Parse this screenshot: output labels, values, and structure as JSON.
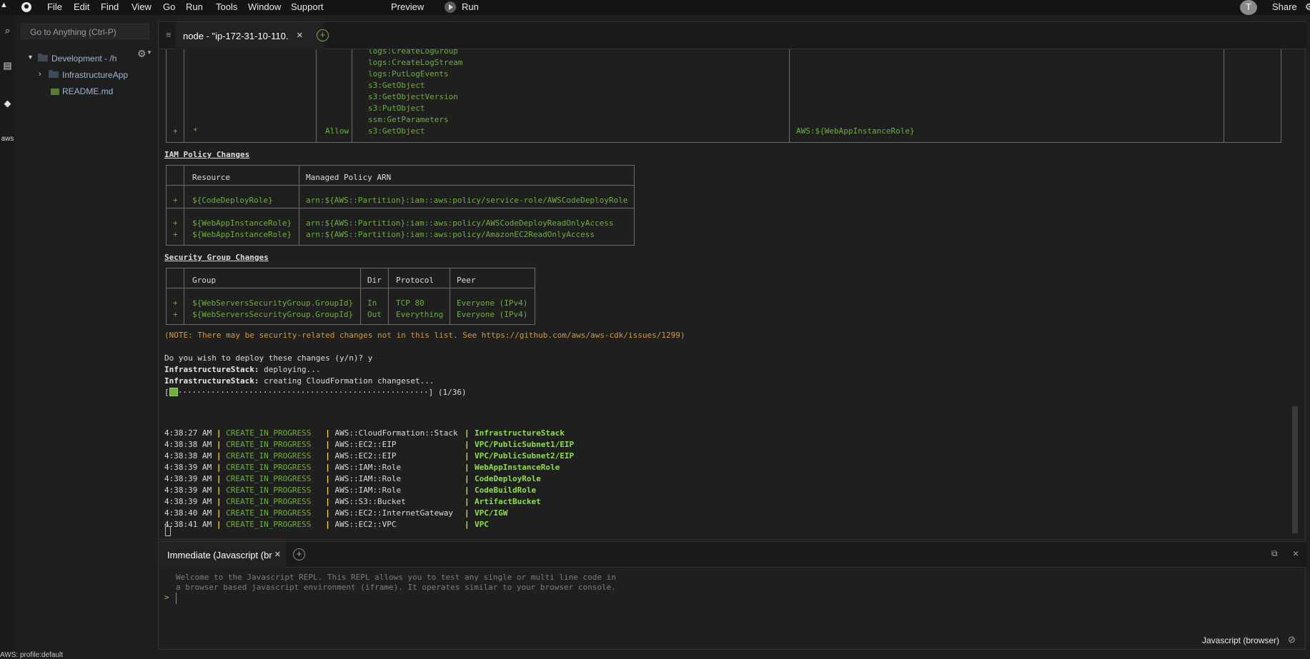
{
  "menubar": {
    "items": [
      "File",
      "Edit",
      "Find",
      "View",
      "Go",
      "Run",
      "Tools",
      "Window",
      "Support"
    ],
    "preview": "Preview",
    "run": "Run",
    "avatar": "T",
    "share": "Share"
  },
  "sidebar": {
    "goto_placeholder": "Go to Anything (Ctrl-P)",
    "root": "Development - /h",
    "folder": "InfrastructureApp",
    "file": "README.md",
    "profile": "AWS: profile:default",
    "rail_aws": "aws"
  },
  "editor": {
    "tab_title": "node - \"ip-172-31-10-110.",
    "close": "×",
    "add": "+",
    "menu": "≡"
  },
  "terminal": {
    "iam_rows": [
      {
        "res": "",
        "effect": "",
        "action": "logs:CreateLogGroup",
        "principal": ""
      },
      {
        "res": "",
        "effect": "",
        "action": "logs:CreateLogStream",
        "principal": ""
      },
      {
        "res": "",
        "effect": "",
        "action": "logs:PutLogEvents",
        "principal": ""
      },
      {
        "res": "",
        "effect": "",
        "action": "s3:GetObject",
        "principal": ""
      },
      {
        "res": "",
        "effect": "",
        "action": "s3:GetObjectVersion",
        "principal": ""
      },
      {
        "res": "",
        "effect": "",
        "action": "s3:PutObject",
        "principal": ""
      },
      {
        "res": "",
        "effect": "",
        "action": "ssm:GetParameters",
        "principal": ""
      },
      {
        "res": "*",
        "effect": "Allow",
        "action": "s3:GetObject",
        "principal": "AWS:${WebAppInstanceRole}",
        "plus": "+"
      }
    ],
    "policy_heading": "IAM Policy Changes",
    "policy_headers": [
      "Resource",
      "Managed Policy ARN"
    ],
    "policy_rows": [
      {
        "plus": "+",
        "res": "${CodeDeployRole}",
        "arn": "arn:${AWS::Partition}:iam::aws:policy/service-role/AWSCodeDeployRole"
      },
      {
        "plus": "+",
        "res": "${WebAppInstanceRole}",
        "arn": "arn:${AWS::Partition}:iam::aws:policy/AWSCodeDeployReadOnlyAccess"
      },
      {
        "plus": "+",
        "res": "${WebAppInstanceRole}",
        "arn": "arn:${AWS::Partition}:iam::aws:policy/AmazonEC2ReadOnlyAccess"
      }
    ],
    "sg_heading": "Security Group Changes",
    "sg_headers": [
      "Group",
      "Dir",
      "Protocol",
      "Peer"
    ],
    "sg_rows": [
      {
        "plus": "+",
        "group": "${WebServersSecurityGroup.GroupId}",
        "dir": "In",
        "proto": "TCP 80",
        "peer": "Everyone (IPv4)"
      },
      {
        "plus": "+",
        "group": "${WebServersSecurityGroup.GroupId}",
        "dir": "Out",
        "proto": "Everything",
        "peer": "Everyone (IPv4)"
      }
    ],
    "note": "(NOTE: There may be security-related changes not in this list. See https://github.com/aws/aws-cdk/issues/1299)",
    "prompt": "Do you wish to deploy these changes (y/n)? y",
    "stack": "InfrastructureStack:",
    "deploying": " deploying...",
    "creating": " creating CloudFormation changeset...",
    "progress_open": "[",
    "progress_dots": "·····················································",
    "progress_close": "] (1/36)",
    "progress_fraction": 0.028,
    "events": [
      {
        "time": "4:38:27 AM",
        "status": "CREATE_IN_PROGRESS",
        "type": "AWS::CloudFormation::Stack",
        "id": "InfrastructureStack"
      },
      {
        "time": "4:38:38 AM",
        "status": "CREATE_IN_PROGRESS",
        "type": "AWS::EC2::EIP",
        "id": "VPC/PublicSubnet1/EIP"
      },
      {
        "time": "4:38:38 AM",
        "status": "CREATE_IN_PROGRESS",
        "type": "AWS::EC2::EIP",
        "id": "VPC/PublicSubnet2/EIP"
      },
      {
        "time": "4:38:39 AM",
        "status": "CREATE_IN_PROGRESS",
        "type": "AWS::IAM::Role",
        "id": "WebAppInstanceRole"
      },
      {
        "time": "4:38:39 AM",
        "status": "CREATE_IN_PROGRESS",
        "type": "AWS::IAM::Role",
        "id": "CodeDeployRole"
      },
      {
        "time": "4:38:39 AM",
        "status": "CREATE_IN_PROGRESS",
        "type": "AWS::IAM::Role",
        "id": "CodeBuildRole"
      },
      {
        "time": "4:38:39 AM",
        "status": "CREATE_IN_PROGRESS",
        "type": "AWS::S3::Bucket",
        "id": "ArtifactBucket"
      },
      {
        "time": "4:38:40 AM",
        "status": "CREATE_IN_PROGRESS",
        "type": "AWS::EC2::InternetGateway",
        "id": "VPC/IGW"
      },
      {
        "time": "4:38:41 AM",
        "status": "CREATE_IN_PROGRESS",
        "type": "AWS::EC2::VPC",
        "id": "VPC"
      }
    ]
  },
  "console": {
    "tab_title": "Immediate (Javascript (br",
    "close": "×",
    "add": "+",
    "welcome1": "Welcome to the Javascript REPL. This REPL allows you to test any single or multi line code in",
    "welcome2": "a browser based javascript environment (iframe). It operates similar to your browser console.",
    "prompt": ">",
    "mode": "Javascript (browser)"
  },
  "colors": {
    "green": "#6fae3f",
    "bright_green": "#8ee04a",
    "yellow": "#ffde3f",
    "orange": "#d59a3a"
  }
}
